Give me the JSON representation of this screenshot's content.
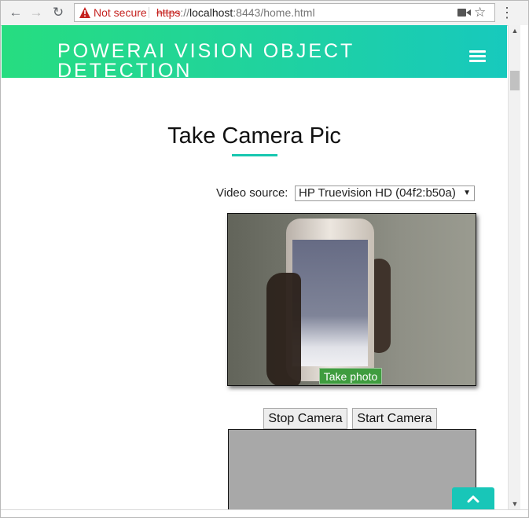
{
  "browser": {
    "security_label": "Not secure",
    "url_scheme": "https",
    "url_separator": "://",
    "url_host": "localhost",
    "url_rest": ":8443/home.html",
    "icons": [
      "back-icon",
      "forward-icon",
      "reload-icon",
      "warning-icon",
      "camera-icon",
      "star-icon",
      "menu-icon"
    ]
  },
  "header": {
    "site_title": "POWERAI VISION OBJECT DETECTION",
    "menu_icon": "hamburger-menu-icon",
    "gradient_colors": [
      "#26dd80",
      "#17c9bd"
    ]
  },
  "main": {
    "page_title": "Take Camera Pic",
    "video_source_label": "Video source:",
    "video_source_selected": "HP Truevision HD (04f2:b50a)",
    "take_photo_label": "Take photo",
    "stop_camera_label": "Stop Camera",
    "start_camera_label": "Start Camera",
    "accent_color": "#17c7b0"
  },
  "back_to_top_icon": "chevron-up-icon"
}
